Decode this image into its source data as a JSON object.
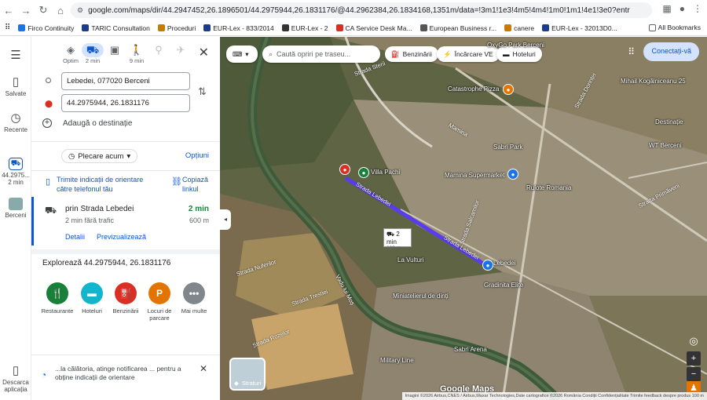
{
  "browser": {
    "url": "google.com/maps/dir/44.2947452,26.1896501/44.2975944,26.1831176/@44.2962384,26.1834168,1351m/data=!3m1!1e3!4m5!4m4!1m0!1m1!4e1!3e0?entry=ttu&g_ep=EgoyMDI2MDU...",
    "bookmarks": [
      "Firco Continuity",
      "TARIC Consultation",
      "Proceduri",
      "EUR-Lex - 833/2014",
      "EUR-Lex - 2",
      "CA Service Desk Ma...",
      "European Business r...",
      "canere",
      "EUR-Lex - 32013D0..."
    ],
    "all_bookmarks": "All Bookmarks"
  },
  "rail": {
    "saved": "Salvate",
    "recent": "Recente",
    "current_line1": "44.2975...",
    "current_line2": "2 min",
    "berceni": "Berceni",
    "download_line1": "Descarca",
    "download_line2": "aplicația"
  },
  "modes": {
    "best": "Optim",
    "car": "2 min",
    "walk": "9 min"
  },
  "route": {
    "origin": "Lebedei, 077020 Berceni",
    "destination": "44.2975944, 26.1831176",
    "add_destination": "Adaugă o destinație",
    "depart": "Plecare acum",
    "options": "Opțiuni",
    "send_to_phone": "Trimite indicații de orientare către telefonul tău",
    "copy_link": "Copiază linkul",
    "via": "prin Strada Lebedei",
    "traffic": "2 min fără trafic",
    "time": "2 min",
    "distance": "600 m",
    "details": "Detalii",
    "preview": "Previzualizează"
  },
  "explore": {
    "title": "Explorează 44.2975944, 26.1831176",
    "items": [
      {
        "label": "Restaurante",
        "color": "#188038"
      },
      {
        "label": "Hoteluri",
        "color": "#12b5cb"
      },
      {
        "label": "Benzinării",
        "color": "#d93025"
      },
      {
        "label": "Locuri de parcare",
        "color": "#e37400"
      },
      {
        "label": "Mai multe",
        "color": "#80868b"
      }
    ]
  },
  "promo": {
    "text": "...la călătoria, atinge notificarea ... pentru a obține indicații de orientare"
  },
  "map": {
    "search_placeholder": "Caută opriri pe traseu...",
    "chips": [
      "Benzinării",
      "Încărcare VE",
      "Hoteluri"
    ],
    "connect": "Conectați-vă",
    "duration": "2 min",
    "duration_dist": "600 m",
    "layers": "Straturi",
    "logo": "Google Maps",
    "attribution": "Imagini ©2026 Airbus,CNES / Airbus,Maxar Technologies,Date cartografice ©2026   România   Condiții   Confidențialitate   Trimite feedback despre produs   100 m",
    "labels": {
      "oxygo": "OxyGo Park Berceni",
      "catastrophe": "Catastrophe Pizza",
      "mihail": "Mihail Kogălniceanu 25",
      "destinatie": "Destinație",
      "sabri_park": "Sabri Park",
      "wt": "WT Berceni",
      "villa": "Villa Pachi",
      "mamina": "Mamina Supermarket",
      "rulote": "Rulote Romania",
      "lebedei": "Lebedei",
      "la_vulturi": "La Vulturi",
      "gradinita": "Gradinita Elite",
      "miniatelier": "Miniatelierul de dinți",
      "sabri_arena": "Sabri Arena",
      "military": "Military Line"
    },
    "streets": {
      "lebedei1": "Strada Lebedei",
      "lebedei2": "Strada Lebedei",
      "vadu": "Vadu lui Moș",
      "tresiei": "Strada Trestiei",
      "nuferilor": "Strada Nuferilor",
      "rozelor": "Strada Rozelor",
      "sterii": "Strada Sterii",
      "mamina_st": "Mamina",
      "primaverii": "Strada Primăverii",
      "dorinței": "Strada Dorinței",
      "salcamilor": "Strada Salcamilor"
    }
  }
}
